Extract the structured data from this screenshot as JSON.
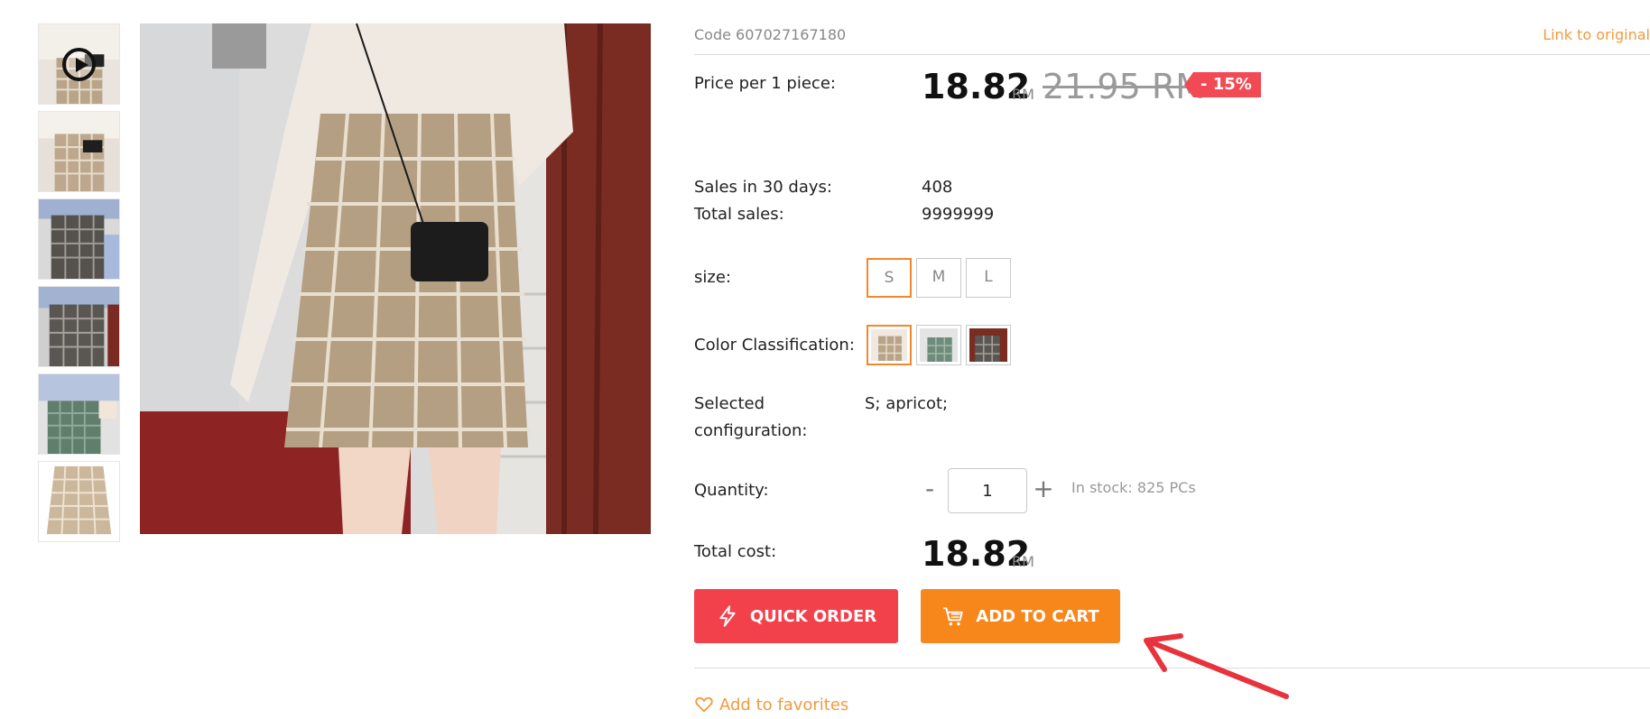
{
  "product": {
    "code": "Code 607027167180",
    "link_original": "Link to original"
  },
  "price": {
    "label": "Price per 1 piece:",
    "current": "18.82",
    "currency": "RM",
    "old": "21.95 RM",
    "discount": "- 15%"
  },
  "sales": {
    "sales_30_label": "Sales in 30 days:",
    "sales_30_value": "408",
    "total_label": "Total sales:",
    "total_value": "9999999"
  },
  "size": {
    "label": "size:",
    "options": [
      "S",
      "M",
      "L"
    ],
    "selected": "S"
  },
  "color": {
    "label": "Color Classification:",
    "options": [
      "apricot",
      "green",
      "gray"
    ],
    "selected": "apricot"
  },
  "configuration": {
    "label_line1": "Selected",
    "label_line2": "configuration:",
    "value": "S; apricot;"
  },
  "quantity": {
    "label": "Quantity:",
    "minus": "-",
    "plus": "+",
    "value": "1",
    "stock": "In stock: 825 PCs"
  },
  "total": {
    "label": "Total cost:",
    "value": "18.82",
    "currency": "RM"
  },
  "buttons": {
    "quick_order": "QUICK ORDER",
    "add_to_cart": "ADD TO CART"
  },
  "favorites": {
    "label": "Add to favorites"
  },
  "colors": {
    "accent_orange": "#f7861b",
    "accent_red": "#f3414c",
    "link_orange": "#f39a3d",
    "arrow_red": "#e8323c"
  },
  "icons": {
    "play": "play-icon",
    "lightning": "lightning-icon",
    "cart": "cart-icon",
    "heart": "heart-icon"
  }
}
